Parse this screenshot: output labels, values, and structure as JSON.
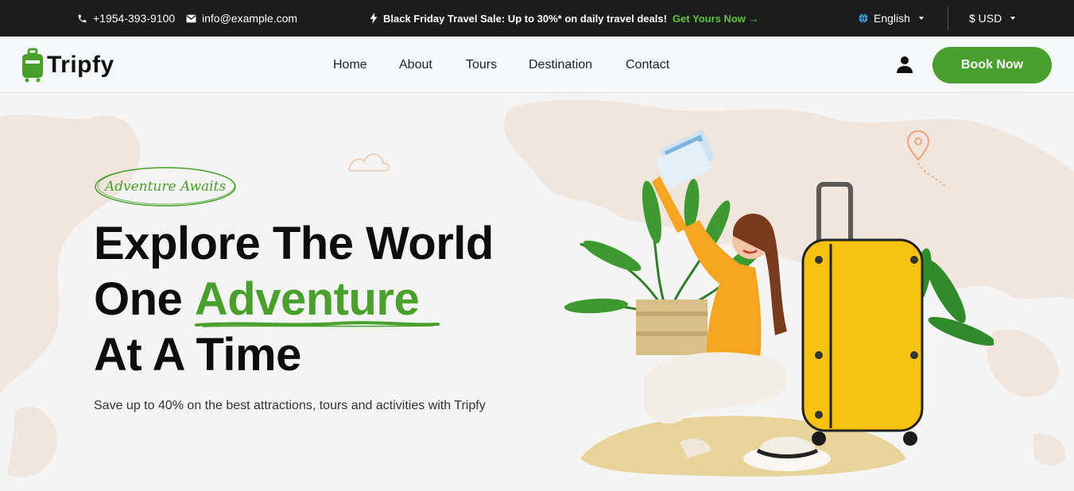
{
  "topbar": {
    "phone": "+1954-393-9100",
    "email": "info@example.com",
    "promo_bold": "Black Friday Travel Sale: Up to 30%* on daily travel deals!",
    "promo_cta": "Get Yours Now →",
    "language": "English",
    "currency": "$ USD"
  },
  "nav": {
    "brand": "Tripfy",
    "items": [
      "Home",
      "About",
      "Tours",
      "Destination",
      "Contact"
    ],
    "book_label": "Book Now"
  },
  "hero": {
    "badge": "Adventure Awaits",
    "line1": "Explore The World",
    "line2_prefix": "One ",
    "line2_highlight": "Adventure",
    "line3": "At A Time",
    "subtext": "Save up to 40% on the best attractions, tours and activities with Tripfy"
  },
  "colors": {
    "brand_green": "#4aa02c",
    "topbar_bg": "#1c1c1c",
    "suitcase_yellow": "#f6c20f",
    "shirt_orange": "#f4a623"
  },
  "icons": [
    "phone-icon",
    "mail-icon",
    "bolt-icon",
    "globe-icon",
    "user-icon",
    "luggage-logo-icon",
    "location-pin-icon",
    "cloud-icon"
  ]
}
